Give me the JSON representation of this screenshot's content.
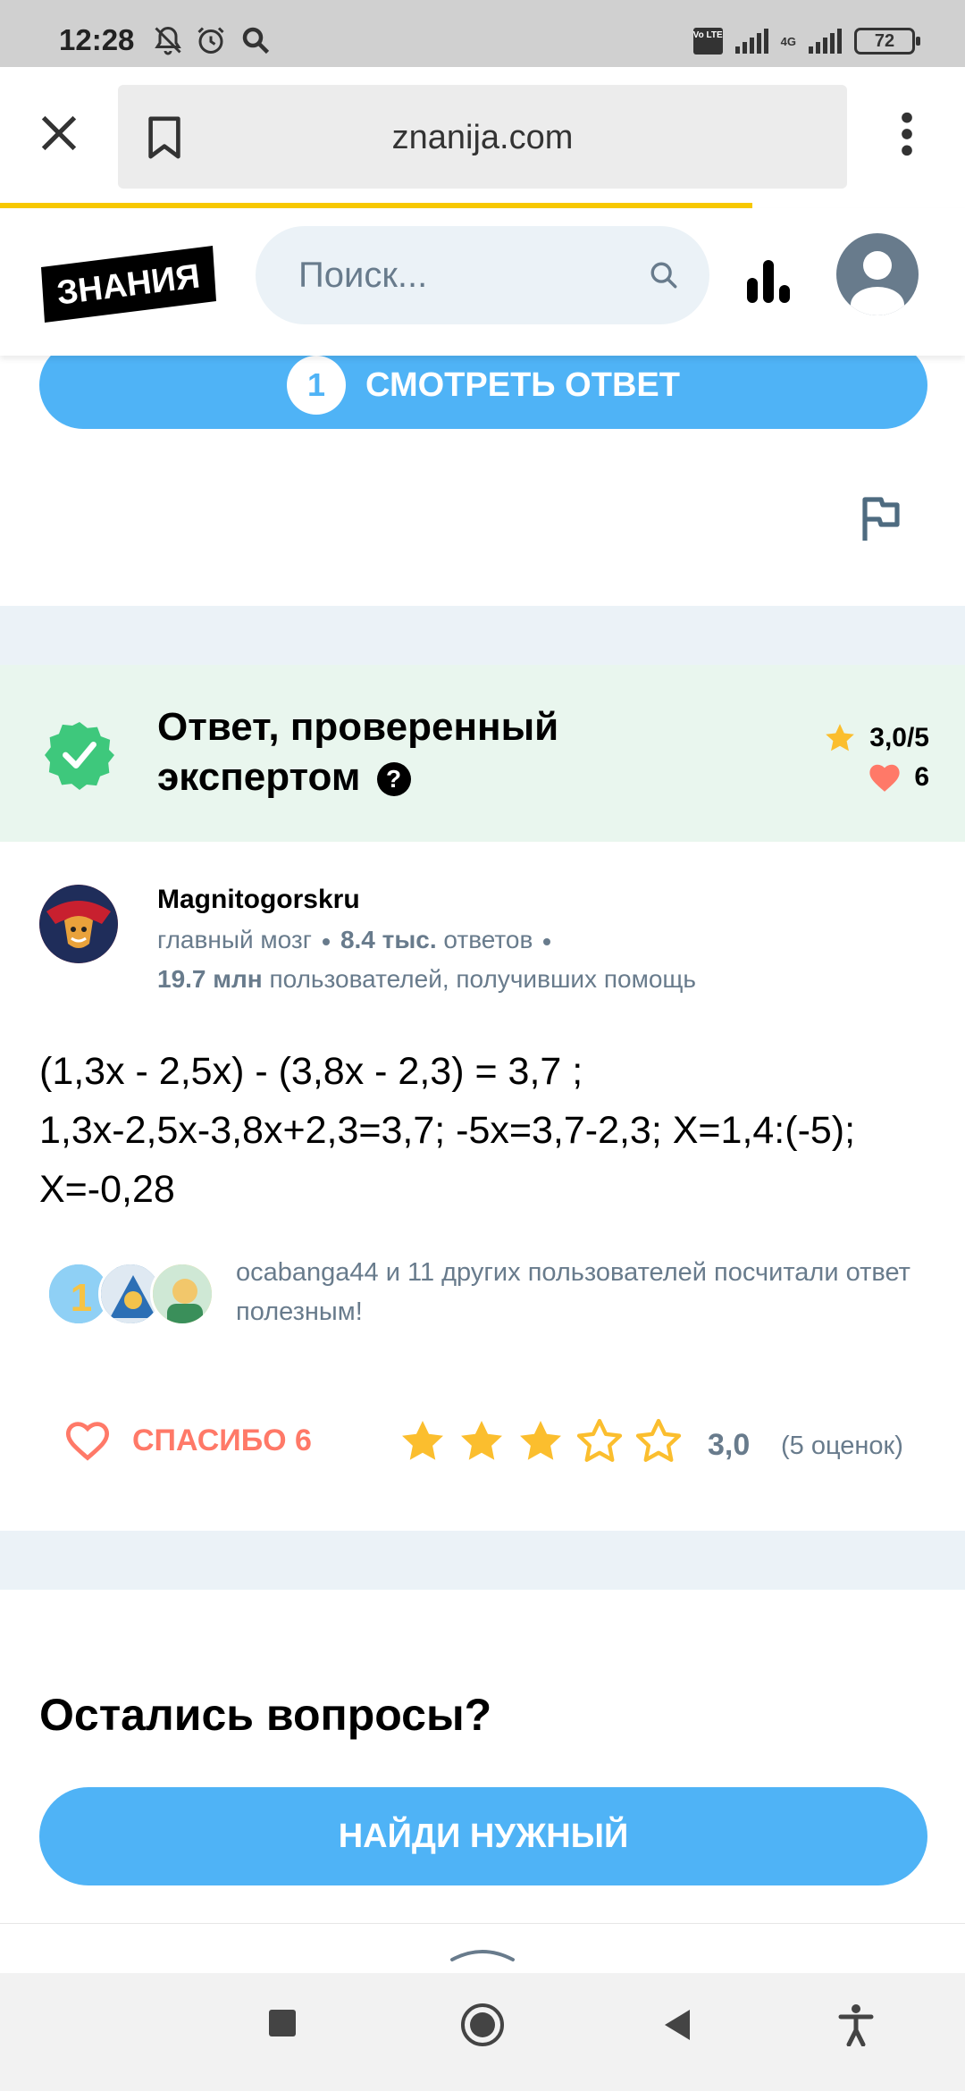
{
  "status_bar": {
    "time": "12:28",
    "volte": "Vo LTE",
    "network": "4G",
    "battery": "72"
  },
  "browser": {
    "url": "znanija.com",
    "progress_percent": 78
  },
  "site_header": {
    "logo_text": "ЗНАНИЯ",
    "search_placeholder": "Поиск..."
  },
  "question": {
    "show_answer_count": "1",
    "show_answer_label": "СМОТРЕТЬ ОТВЕТ"
  },
  "expert_answer": {
    "title": "Ответ, проверенный экспертом",
    "help_glyph": "?",
    "rating": "3,0/5",
    "likes": "6"
  },
  "author": {
    "name": "Magnitogorskru",
    "rank": "главный мозг",
    "answers_count": "8.4 тыс.",
    "answers_label": "ответов",
    "helped_count": "19.7 млн",
    "helped_label": "пользователей, получивших помощь"
  },
  "answer": {
    "lines": [
      "(1,3x - 2,5x) - (3,8x - 2,3) = 3,7 ;",
      "1,3x-2,5x-3,8x+2,3=3,7; -5x=3,7-2,3; X=1,4:(-5);",
      "X=-0,28"
    ],
    "helpful_text": "ocabanga44 и 11 других пользователей посчитали ответ полезным!"
  },
  "actions": {
    "thanks_label": "СПАСИБО 6",
    "stars_filled": 3,
    "stars_total": 5,
    "rating_value": "3,0",
    "rating_count": "(5 оценок)"
  },
  "footer": {
    "questions_title": "Остались вопросы?",
    "find_button": "НАЙДИ НУЖНЫЙ"
  },
  "colors": {
    "primary_blue": "#4fb3f6",
    "expert_bg": "#e9f6ee",
    "expert_green": "#3ec87c",
    "heart_red": "#ff7968",
    "star_yellow": "#fbbe2e",
    "muted_gray": "#687b8c",
    "progress_yellow": "#f7c800"
  }
}
